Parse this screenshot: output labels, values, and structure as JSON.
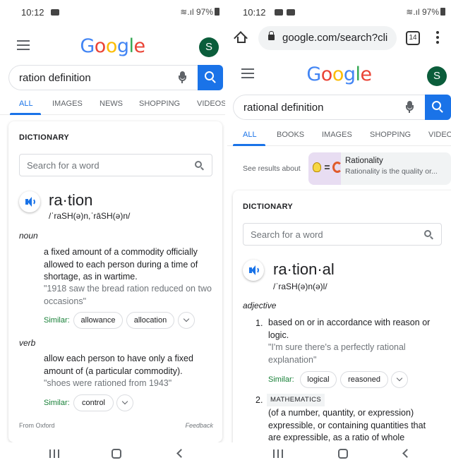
{
  "left": {
    "status": {
      "time": "10:12",
      "battery": "97%"
    },
    "logo": "Google",
    "avatar": "S",
    "query": "ration definition",
    "tabs": [
      "ALL",
      "IMAGES",
      "NEWS",
      "SHOPPING",
      "VIDEOS"
    ],
    "dictionary": {
      "label": "DICTIONARY",
      "search_placeholder": "Search for a word",
      "headword": "ra·tion",
      "phonetic": "/ˈraSH(ə)n,ˈrāSH(ə)n/",
      "noun": {
        "pos": "noun",
        "definition_lines": [
          "a fixed amount of a commodity officially",
          "allowed to each person during a time of",
          "shortage, as in wartime."
        ],
        "example_lines": [
          "\"1918 saw the bread ration reduced on two",
          "occasions\""
        ],
        "similar_label": "Similar:",
        "similar": [
          "allowance",
          "allocation"
        ]
      },
      "verb": {
        "pos": "verb",
        "definition_lines": [
          "allow each person to have only a fixed",
          "amount of (a particular commodity)."
        ],
        "example_lines": [
          "\"shoes were rationed from 1943\""
        ],
        "similar_label": "Similar:",
        "similar": [
          "control"
        ]
      },
      "source": "From Oxford",
      "feedback": "Feedback"
    }
  },
  "right": {
    "status": {
      "time": "10:12",
      "battery": "97%"
    },
    "url": "google.com/search?cli",
    "tab_count": "14",
    "logo": "Google",
    "avatar": "S",
    "query": "rational definition",
    "tabs": [
      "ALL",
      "BOOKS",
      "IMAGES",
      "SHOPPING",
      "VIDEOS"
    ],
    "see_results": {
      "label": "See results about",
      "title": "Rationality",
      "description": "Rationality is the quality or..."
    },
    "dictionary": {
      "label": "DICTIONARY",
      "search_placeholder": "Search for a word",
      "headword": "ra·tion·al",
      "phonetic": "/ˈraSH(ə)n(ə)l/",
      "adjective": {
        "pos": "adjective",
        "sense1": {
          "number": "1.",
          "definition_lines": [
            "based on or in accordance with reason or",
            "logic."
          ],
          "example_lines": [
            "\"I'm sure there's a perfectly rational",
            "explanation\""
          ],
          "similar_label": "Similar:",
          "similar": [
            "logical",
            "reasoned"
          ]
        },
        "sense2": {
          "number": "2.",
          "domain": "MATHEMATICS",
          "definition_lines": [
            "(of a number, quantity, or expression)",
            "expressible, or containing quantities that",
            "are expressible, as a ratio of whole"
          ]
        }
      }
    }
  }
}
